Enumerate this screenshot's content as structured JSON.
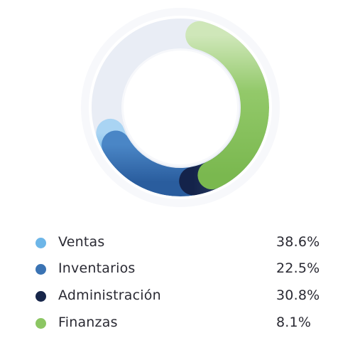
{
  "chart_data": {
    "type": "pie",
    "variant": "donut",
    "categories": [
      "Ventas",
      "Inventarios",
      "Administración",
      "Finanzas"
    ],
    "values": [
      38.6,
      22.5,
      30.8,
      8.1
    ],
    "labels": [
      "38.6%",
      "22.5%",
      "30.8%",
      "8.1%"
    ],
    "colors": [
      "#6db6e8",
      "#3a73b3",
      "#17264a",
      "#8cc663"
    ],
    "legend_position": "bottom"
  }
}
